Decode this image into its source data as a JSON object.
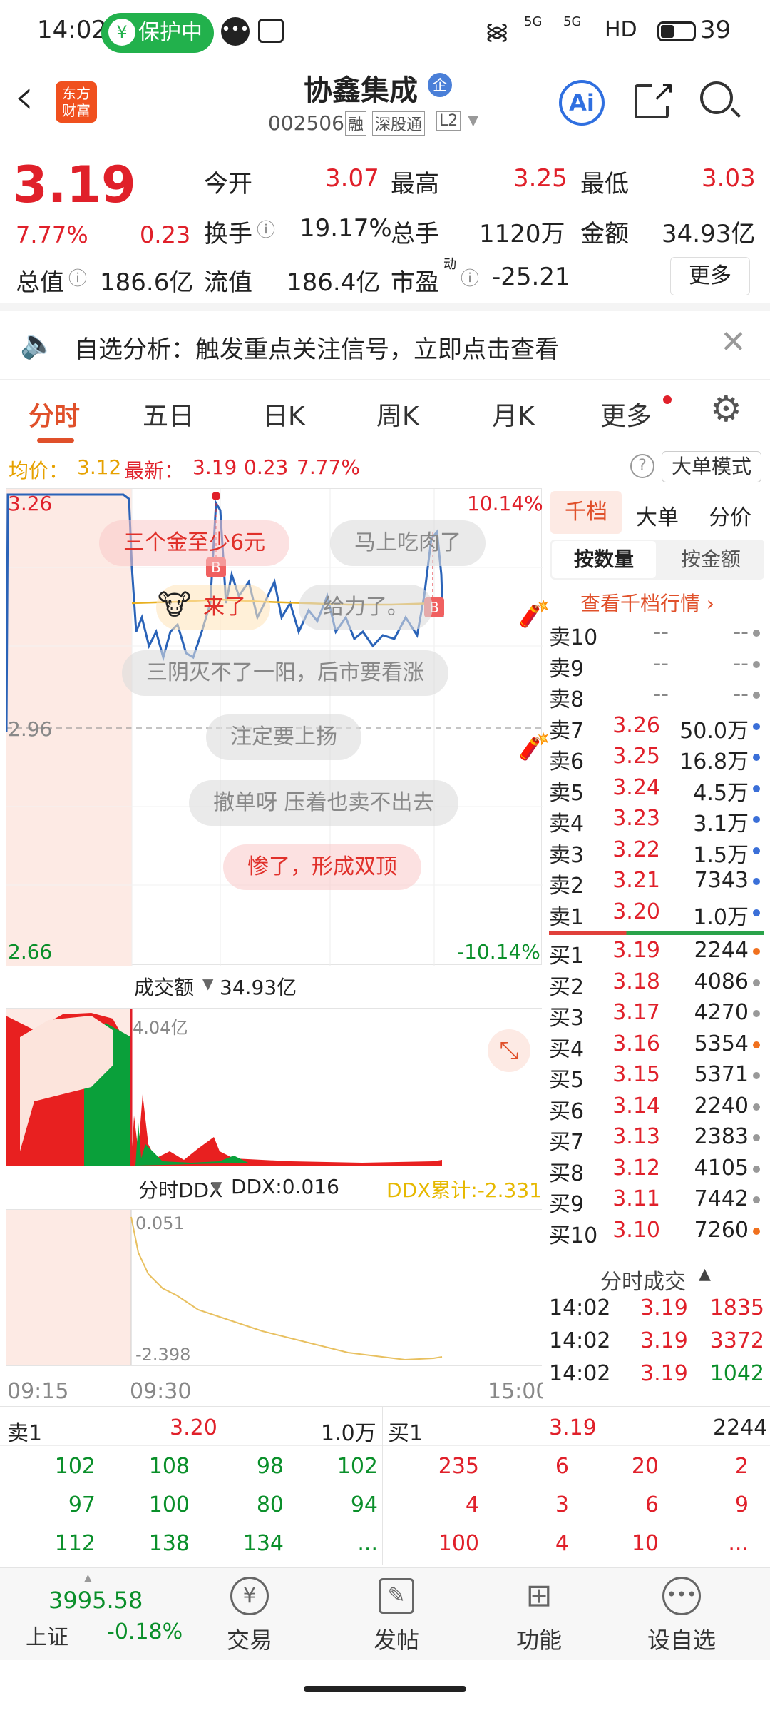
{
  "status": {
    "time": "14:02",
    "protect": "保护中",
    "battery": "39",
    "net1": "5G",
    "net2": "5G",
    "hd": "HD"
  },
  "header": {
    "back": "‹",
    "logo": "东方\n财富",
    "title": "协鑫集成",
    "badge": "企",
    "code": "002506",
    "tags": [
      "融",
      "深股通",
      "L2"
    ],
    "ai": "Ai"
  },
  "quote": {
    "price": "3.19",
    "pct": "7.77%",
    "chg": "0.23",
    "open_l": "今开",
    "open": "3.07",
    "high_l": "最高",
    "high": "3.25",
    "low_l": "最低",
    "low": "3.03",
    "turn_l": "换手",
    "turn": "19.17%",
    "vol_l": "总手",
    "vol": "1120万",
    "amt_l": "金额",
    "amt": "34.93亿",
    "mv_l": "总值",
    "mv": "186.6亿",
    "fmv_l": "流值",
    "fmv": "186.4亿",
    "pe_l": "市盈",
    "pe_sup": "动",
    "pe": "-25.21",
    "more": "更多"
  },
  "banner": {
    "text": "自选分析：触发重点关注信号，立即点击查看"
  },
  "tabs": [
    "分时",
    "五日",
    "日K",
    "周K",
    "月K",
    "更多"
  ],
  "info": {
    "avg_l": "均价：",
    "avg": "3.12",
    "new_l": "最新：",
    "new": "3.19",
    "chg": "0.23",
    "pct": "7.77%",
    "mode": "大单模式"
  },
  "chart": {
    "top": "3.26",
    "mid": "2.96",
    "bot": "2.66",
    "top_pct": "10.14%",
    "bot_pct": "-10.14%",
    "vol_l": "成交额",
    "vol": "34.93亿",
    "vol_max": "4.04亿",
    "ddx_l": "分时DDX",
    "ddx": "DDX:0.016",
    "ddx_sum": "DDX累计:-2.331",
    "ddx_top": "0.051",
    "ddx_bot": "-2.398",
    "t1": "09:15",
    "t2": "09:30",
    "t3": "15:00",
    "b": "B"
  },
  "danmu": [
    "三个金至少6元",
    "马上吃肉了",
    "来了",
    "给力了。",
    "三阴灭不了一阳，后市要看涨",
    "注定要上扬",
    "撤单呀 压着也卖不出去",
    "惨了，形成双顶"
  ],
  "orderbook": {
    "tab1": "千档",
    "tab2": "大单",
    "tab3": "分价",
    "sub1": "按数量",
    "sub2": "按金额",
    "link": "查看千档行情 ›",
    "asks": [
      {
        "n": "卖10",
        "p": "--",
        "v": "--"
      },
      {
        "n": "卖9",
        "p": "--",
        "v": "--"
      },
      {
        "n": "卖8",
        "p": "--",
        "v": "--"
      },
      {
        "n": "卖7",
        "p": "3.26",
        "v": "50.0万"
      },
      {
        "n": "卖6",
        "p": "3.25",
        "v": "16.8万"
      },
      {
        "n": "卖5",
        "p": "3.24",
        "v": "4.5万"
      },
      {
        "n": "卖4",
        "p": "3.23",
        "v": "3.1万"
      },
      {
        "n": "卖3",
        "p": "3.22",
        "v": "1.5万"
      },
      {
        "n": "卖2",
        "p": "3.21",
        "v": "7343"
      },
      {
        "n": "卖1",
        "p": "3.20",
        "v": "1.0万"
      }
    ],
    "bids": [
      {
        "n": "买1",
        "p": "3.19",
        "v": "2244"
      },
      {
        "n": "买2",
        "p": "3.18",
        "v": "4086"
      },
      {
        "n": "买3",
        "p": "3.17",
        "v": "4270"
      },
      {
        "n": "买4",
        "p": "3.16",
        "v": "5354"
      },
      {
        "n": "买5",
        "p": "3.15",
        "v": "5371"
      },
      {
        "n": "买6",
        "p": "3.14",
        "v": "2240"
      },
      {
        "n": "买7",
        "p": "3.13",
        "v": "2383"
      },
      {
        "n": "买8",
        "p": "3.12",
        "v": "4105"
      },
      {
        "n": "买9",
        "p": "3.11",
        "v": "7442"
      },
      {
        "n": "买10",
        "p": "3.10",
        "v": "7260"
      }
    ],
    "trades_l": "分时成交",
    "trades": [
      {
        "t": "14:02",
        "p": "3.19",
        "v": "1835"
      },
      {
        "t": "14:02",
        "p": "3.19",
        "v": "3372"
      },
      {
        "t": "14:02",
        "p": "3.19",
        "v": "1042"
      }
    ]
  },
  "queue": {
    "sell_l": "卖1",
    "sell_p": "3.20",
    "sell_v": "1.0万",
    "buy_l": "买1",
    "buy_p": "3.19",
    "buy_v": "2244",
    "sell_rows": [
      [
        "102",
        "108",
        "98",
        "102"
      ],
      [
        "97",
        "100",
        "80",
        "94"
      ],
      [
        "112",
        "138",
        "134",
        "..."
      ]
    ],
    "buy_rows": [
      [
        "235",
        "6",
        "20",
        "2"
      ],
      [
        "4",
        "3",
        "6",
        "9"
      ],
      [
        "100",
        "4",
        "10",
        "..."
      ]
    ]
  },
  "nav": {
    "index": "3995.58",
    "index_name": "上证",
    "index_pct": "-0.18%",
    "items": [
      "交易",
      "发帖",
      "功能",
      "设自选"
    ]
  }
}
